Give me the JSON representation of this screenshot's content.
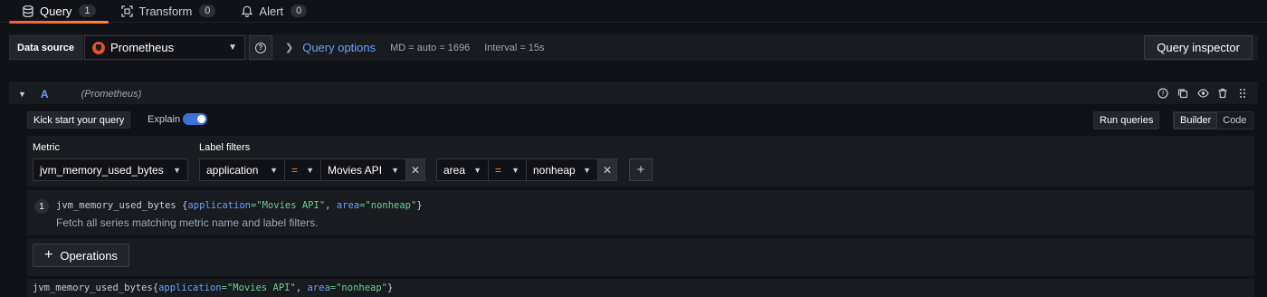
{
  "tabs": [
    {
      "label": "Query",
      "count": "1",
      "icon": "database-icon"
    },
    {
      "label": "Transform",
      "count": "0",
      "icon": "transform-icon"
    },
    {
      "label": "Alert",
      "count": "0",
      "icon": "bell-icon"
    }
  ],
  "toolbar": {
    "datasource_label": "Data source",
    "datasource_value": "Prometheus",
    "query_options_label": "Query options",
    "md": "MD = auto = 1696",
    "interval": "Interval = 15s",
    "query_inspector_label": "Query inspector"
  },
  "query_row": {
    "ref_id": "A",
    "datasource": "(Prometheus)"
  },
  "editor": {
    "kick_start_label": "Kick start your query",
    "explain_label": "Explain",
    "explain_enabled": true,
    "run_queries_label": "Run queries",
    "modes": [
      "Builder",
      "Code"
    ],
    "active_mode": "Builder"
  },
  "builder": {
    "metric_label": "Metric",
    "metric_value": "jvm_memory_used_bytes",
    "label_filters_label": "Label filters",
    "filters": [
      {
        "key": "application",
        "op": "=",
        "value": "Movies API"
      },
      {
        "key": "area",
        "op": "=",
        "value": "nonheap"
      }
    ]
  },
  "explain_panel": {
    "line_number": "1",
    "metric": "jvm_memory_used_bytes",
    "open_brace": " {",
    "k1": "application",
    "v1": "=\"Movies API\"",
    "sep": ", ",
    "k2": "area",
    "v2": "=\"nonheap\"",
    "close_brace": "}",
    "description": "Fetch all series matching metric name and label filters."
  },
  "operations": {
    "label": "Operations"
  },
  "preview": {
    "metric": "jvm_memory_used_bytes",
    "open": "{",
    "k1": "application",
    "v1": "=\"Movies API\"",
    "sep": ", ",
    "k2": "area",
    "v2": "=\"nonheap\"",
    "close": "}"
  }
}
